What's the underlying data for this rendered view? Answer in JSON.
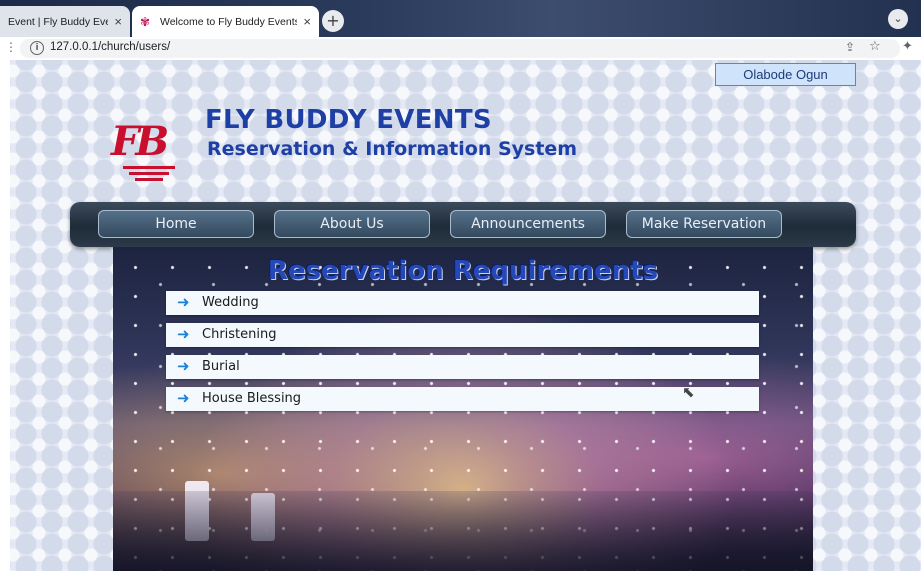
{
  "browser": {
    "tabs": [
      {
        "title": "Event | Fly Buddy Event",
        "active": false
      },
      {
        "title": "Welcome to Fly Buddy Events",
        "active": true
      }
    ],
    "close_glyph": "×",
    "new_tab_glyph": "+",
    "tab_search_glyph": "⌄",
    "url": "127.0.0.1/church/users/",
    "info_glyph": "i",
    "icons": [
      "info-icon",
      "share-icon",
      "star-icon",
      "extensions-icon",
      "new-tab-icon",
      "tab-search-icon"
    ]
  },
  "header": {
    "user_name": "Olabode Ogun",
    "logo_letters": "FB",
    "title": "FLY BUDDY EVENTS",
    "subtitle": "Reservation & Information System"
  },
  "nav": {
    "items": [
      {
        "label": "Home"
      },
      {
        "label": "About Us"
      },
      {
        "label": "Announcements"
      },
      {
        "label": "Make Reservation"
      }
    ]
  },
  "main": {
    "title": "Reservation Requirements",
    "items": [
      {
        "label": "Wedding"
      },
      {
        "label": "Christening"
      },
      {
        "label": "Burial"
      },
      {
        "label": "House Blessing"
      }
    ]
  },
  "colors": {
    "brand_blue": "#1e3fa5",
    "logo_red": "#c8102e",
    "nav_dark": "#1e2b38",
    "arrow_blue": "#1e7fd6"
  }
}
